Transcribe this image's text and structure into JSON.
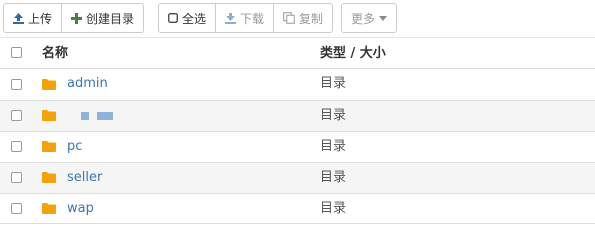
{
  "toolbar": {
    "upload_label": "上传",
    "create_dir_label": "创建目录",
    "select_all_label": "全选",
    "download_label": "下载",
    "copy_label": "复制",
    "more_label": "更多",
    "icons": {
      "upload": "upload-icon",
      "create_dir": "plus-icon",
      "select_all": "square-icon",
      "download": "download-icon",
      "copy": "copy-icon",
      "more": "caret-down-icon"
    },
    "colors": {
      "create_dir_icon": "#3c8b3c",
      "upload_icon": "#2e6b9e"
    }
  },
  "table": {
    "headers": {
      "name": "名称",
      "type": "类型 / 大小"
    },
    "rows": [
      {
        "name": "admin",
        "type": "目录"
      },
      {
        "name": "",
        "type": "目录",
        "redacted": true
      },
      {
        "name": "pc",
        "type": "目录"
      },
      {
        "name": "seller",
        "type": "目录"
      },
      {
        "name": "wap",
        "type": "目录"
      }
    ],
    "colors": {
      "folder": "#f0a30a",
      "link": "#3a78b0",
      "stripe": "#f5f5f5"
    }
  }
}
